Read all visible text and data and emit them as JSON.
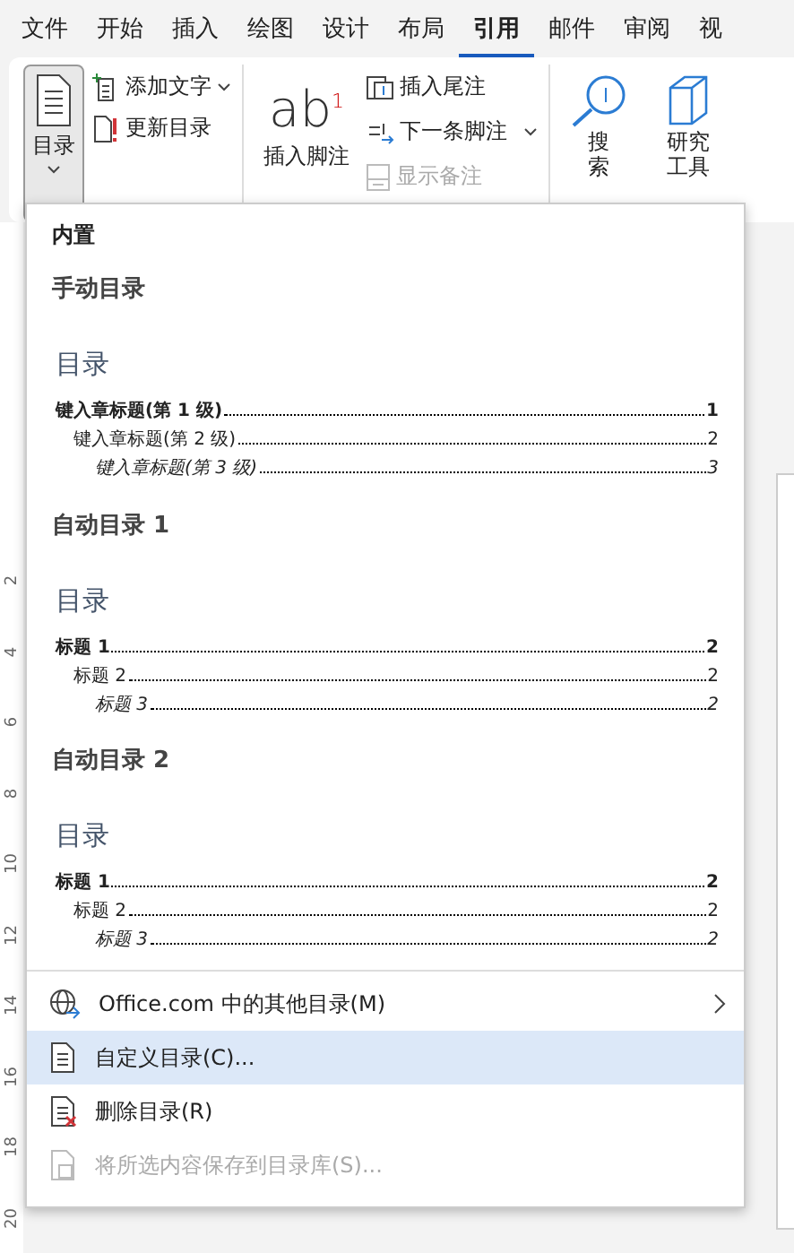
{
  "tabs": [
    {
      "label": "文件",
      "selected": false
    },
    {
      "label": "开始",
      "selected": false
    },
    {
      "label": "插入",
      "selected": false
    },
    {
      "label": "绘图",
      "selected": false
    },
    {
      "label": "设计",
      "selected": false
    },
    {
      "label": "布局",
      "selected": false
    },
    {
      "label": "引用",
      "selected": true
    },
    {
      "label": "邮件",
      "selected": false
    },
    {
      "label": "审阅",
      "selected": false
    },
    {
      "label": "视",
      "selected": false
    }
  ],
  "ribbon": {
    "toc_button": {
      "label": "目录",
      "pressed": true
    },
    "add_text": {
      "label": "添加文字"
    },
    "update_toc": {
      "label": "更新目录"
    },
    "footnote": {
      "icon_text": "ab$^{1}$",
      "label": "插入脚注"
    },
    "endnote": {
      "label": "插入尾注"
    },
    "next_footnote": {
      "label": "下一条脚注"
    },
    "show_notes": {
      "label": "显示备注",
      "disabled": true
    },
    "search": {
      "label": "搜索"
    },
    "research": {
      "label": "研究工具"
    }
  },
  "ruler": [
    "2",
    "4",
    "6",
    "8",
    "10",
    "12",
    "14",
    "16",
    "18",
    "20"
  ],
  "menu": {
    "heading": "内置",
    "gallery": [
      {
        "title": "手动目录",
        "preview": {
          "heading": "目录",
          "entries": [
            {
              "text": "键入章标题(第 1 级)",
              "page": "1",
              "children": [
                {
                  "text": "键入章标题(第 2 级)",
                  "page": "2",
                  "children": [
                    {
                      "text": "键入章标题(第 3 级)",
                      "page": "3"
                    }
                  ]
                }
              ]
            }
          ]
        }
      },
      {
        "title": "自动目录 1",
        "preview": {
          "heading": "目录",
          "entries": [
            {
              "text": "标题 1",
              "page": "2",
              "children": [
                {
                  "text": "标题 2",
                  "page": "2",
                  "children": [
                    {
                      "text": "标题 3",
                      "page": "2"
                    }
                  ]
                }
              ]
            }
          ]
        }
      },
      {
        "title": "自动目录 2",
        "preview": {
          "heading": "目录",
          "entries": [
            {
              "text": "标题 1",
              "page": "2",
              "children": [
                {
                  "text": "标题 2",
                  "page": "2",
                  "children": [
                    {
                      "text": "标题 3",
                      "page": "2"
                    }
                  ]
                }
              ]
            }
          ]
        }
      }
    ],
    "items": [
      {
        "kind": "globe",
        "label": "Office.com 中的其他目录(M)",
        "submenu": true,
        "selected": false,
        "disabled": false
      },
      {
        "kind": "document",
        "label": "自定义目录(C)...",
        "submenu": false,
        "selected": true,
        "disabled": false
      },
      {
        "kind": "remove",
        "label": "删除目录(R)",
        "submenu": false,
        "selected": false,
        "disabled": false
      },
      {
        "kind": "save",
        "label": "将所选内容保存到目录库(S)...",
        "submenu": false,
        "selected": false,
        "disabled": true
      }
    ]
  }
}
